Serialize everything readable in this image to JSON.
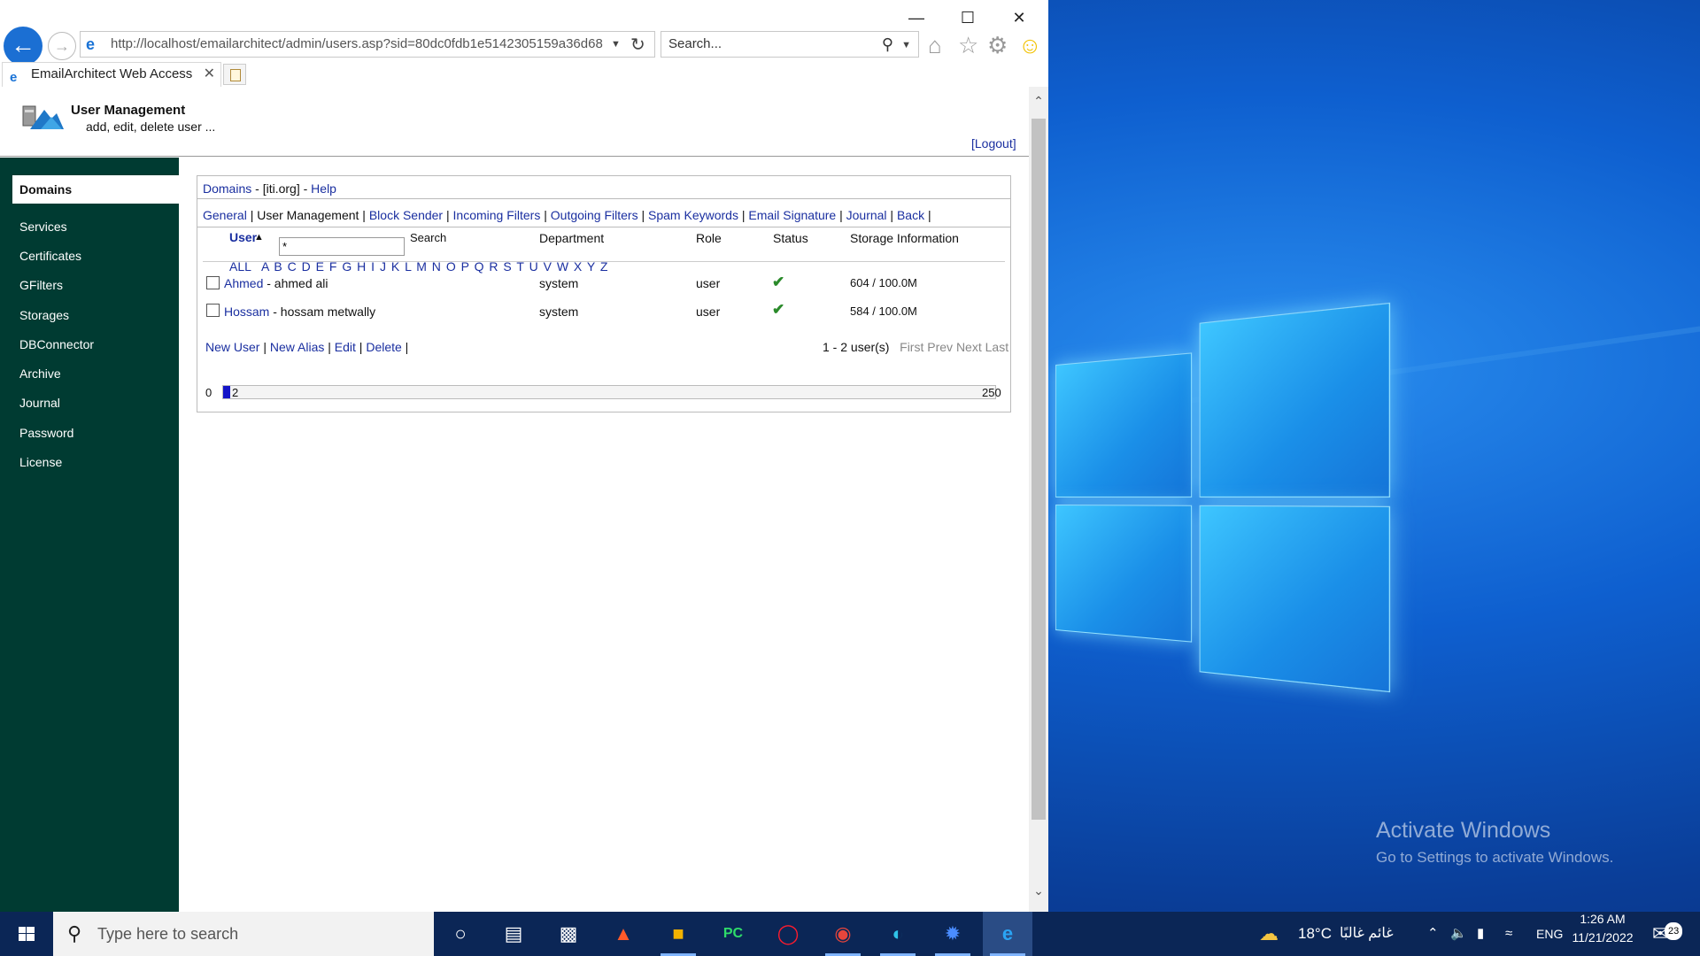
{
  "browser": {
    "url": "http://localhost/emailarchitect/admin/users.asp?sid=80dc0fdb1e5142305159a36d68",
    "search_placeholder": "Search...",
    "tab_title": "EmailArchitect Web Access"
  },
  "header": {
    "title": "User Management",
    "subtitle": "add, edit, delete user ...",
    "logout": "[Logout]"
  },
  "sidebar": {
    "active": "Domains",
    "items": [
      "Services",
      "Certificates",
      "GFilters",
      "Storages",
      "DBConnector",
      "Archive",
      "Journal",
      "Password",
      "License"
    ]
  },
  "breadcrumb": {
    "domains": "Domains",
    "sep1": " - ",
    "domain": "[iti.org]",
    "sep2": " - ",
    "help": "Help"
  },
  "nav": {
    "general": "General",
    "user_management": "User Management",
    "block_sender": "Block Sender",
    "incoming_filters": "Incoming Filters",
    "outgoing_filters": "Outgoing Filters",
    "spam_keywords": "Spam Keywords",
    "email_signature": "Email Signature",
    "journal": "Journal",
    "back": "Back"
  },
  "table": {
    "col_user": "User",
    "sort_glyph": "▲",
    "filter_value": "*",
    "search_label": "Search",
    "col_department": "Department",
    "col_role": "Role",
    "col_status": "Status",
    "col_storage": "Storage Information",
    "letters": [
      "ALL",
      "A",
      "B",
      "C",
      "D",
      "E",
      "F",
      "G",
      "H",
      "I",
      "J",
      "K",
      "L",
      "M",
      "N",
      "O",
      "P",
      "Q",
      "R",
      "S",
      "T",
      "U",
      "V",
      "W",
      "X",
      "Y",
      "Z"
    ],
    "rows": [
      {
        "user": "Ahmed",
        "name": " - ahmed ali",
        "department": "system",
        "role": "user",
        "status": "✔",
        "storage": "604 / 100.0M"
      },
      {
        "user": "Hossam",
        "name": " - hossam metwally",
        "department": "system",
        "role": "user",
        "status": "✔",
        "storage": "584 / 100.0M"
      }
    ]
  },
  "actions": {
    "new_user": "New User",
    "new_alias": "New Alias",
    "edit": "Edit",
    "delete": "Delete"
  },
  "paging": {
    "count": "1 - 2 user(s)",
    "first": "First",
    "prev": "Prev",
    "next": "Next",
    "last": "Last"
  },
  "quota": {
    "min": "0",
    "current": "2",
    "max": "250",
    "fraction": 0.008
  },
  "desktop": {
    "activate_title": "Activate Windows",
    "activate_sub": "Go to Settings to activate Windows."
  },
  "taskbar": {
    "search_placeholder": "Type here to search",
    "weather": "18°C",
    "weather_text": "غائم غالبًا",
    "lang": "ENG",
    "time": "1:26 AM",
    "date": "11/21/2022",
    "notifications": "23"
  }
}
